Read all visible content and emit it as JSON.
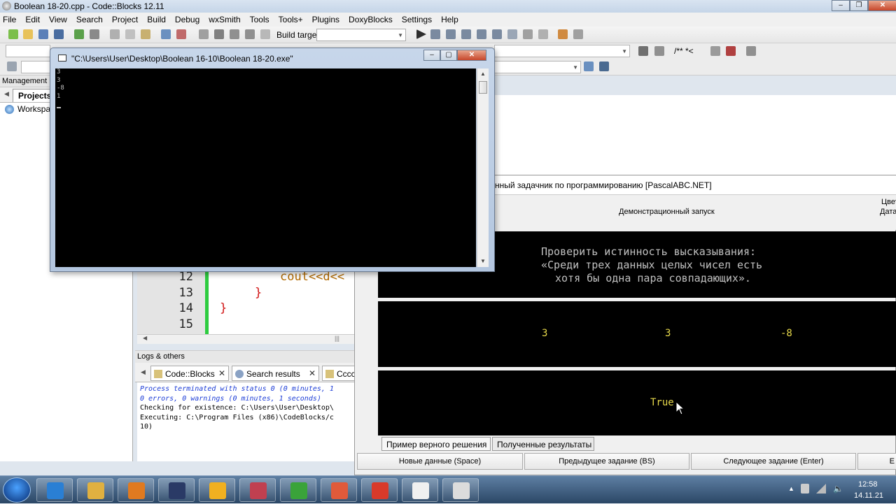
{
  "codeblocks": {
    "window_title": "Boolean 18-20.cpp - Code::Blocks 12.11",
    "menu": [
      "File",
      "Edit",
      "View",
      "Search",
      "Project",
      "Build",
      "Debug",
      "wxSmith",
      "Tools",
      "Tools+",
      "Plugins",
      "DoxyBlocks",
      "Settings",
      "Help"
    ],
    "build_target_label": "Build target:",
    "toolbar2_extra": "/** *<",
    "management": {
      "header": "Management",
      "tab": "Projects",
      "workspace": "Workspa"
    },
    "editor": {
      "lines": [
        {
          "num": "12",
          "code": "cout<<d<<"
        },
        {
          "num": "13",
          "code": "}"
        },
        {
          "num": "14",
          "code": "}"
        },
        {
          "num": "15",
          "code": ""
        }
      ]
    },
    "logs": {
      "header": "Logs & others",
      "tabs": [
        "Code::Blocks",
        "Search results",
        "Cccc"
      ],
      "lines": [
        "Process terminated with status 0 (0 minutes, 1",
        "0 errors, 0 warnings (0 minutes, 1 seconds)",
        "",
        "Checking for existence: C:\\Users\\User\\Desktop\\",
        "Executing: C:\\Program Files (x86)\\CodeBlocks/c",
        "10)"
      ]
    }
  },
  "console": {
    "title": "\"C:\\Users\\User\\Desktop\\Boolean 16-10\\Boolean 18-20.exe\"",
    "output": "3\n3\n-8\n1"
  },
  "pascalabc": {
    "title": "нный задачник по программированию [PascalABC.NET]",
    "mode": "Демонстрационный запуск",
    "right_labels": [
      "Цвет",
      "Дата"
    ],
    "task_lines": [
      "Проверить истинность высказывания:",
      "«Среди трех данных целых чисел есть",
      "хотя бы одна пара совпадающих»."
    ],
    "data_values": [
      "3",
      "3",
      "-8"
    ],
    "result": "True",
    "tabs": [
      "Пример верного решения",
      "Полученные результаты"
    ],
    "buttons": [
      "Новые данные (Space)",
      "Предыдущее задание (BS)",
      "Следующее задание (Enter)",
      "E"
    ]
  },
  "taskbar": {
    "apps": [
      {
        "icon": "ie-icon",
        "color": "#2a7fd4"
      },
      {
        "icon": "explorer-icon",
        "color": "#e0b040"
      },
      {
        "icon": "media-player-icon",
        "color": "#e07a20"
      },
      {
        "icon": "far-manager-icon",
        "color": "#2a3a66"
      },
      {
        "icon": "app-b-icon",
        "color": "#f0b020"
      },
      {
        "icon": "scissors-icon",
        "color": "#c04050"
      },
      {
        "icon": "codeblocks-icon",
        "color": "#3aa33a"
      },
      {
        "icon": "c-app-icon",
        "color": "#e05a3a"
      },
      {
        "icon": "office-icon",
        "color": "#d93a2a"
      },
      {
        "icon": "abc-net-icon",
        "color": "#f0f0f0"
      },
      {
        "icon": "console-icon",
        "color": "#dcdcdc"
      }
    ],
    "clock_time": "12:58",
    "clock_date": "14.11.21"
  }
}
